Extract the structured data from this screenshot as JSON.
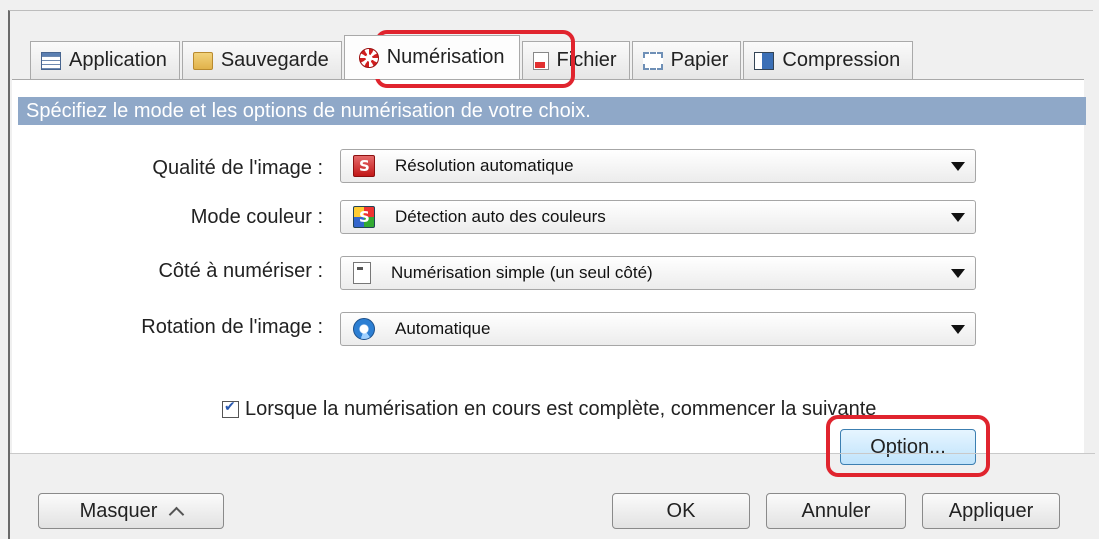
{
  "tabs": [
    {
      "label": "Application",
      "icon": "application-icon",
      "active": false
    },
    {
      "label": "Sauvegarde",
      "icon": "folder-icon",
      "active": false
    },
    {
      "label": "Numérisation",
      "icon": "scan-icon",
      "active": true
    },
    {
      "label": "Fichier",
      "icon": "file-icon",
      "active": false
    },
    {
      "label": "Papier",
      "icon": "paper-icon",
      "active": false
    },
    {
      "label": "Compression",
      "icon": "compression-icon",
      "active": false
    }
  ],
  "header": {
    "text": "Spécifiez le mode et les options de numérisation de votre choix."
  },
  "settings": {
    "quality": {
      "label": "Qualité de l'image :",
      "value": "Résolution automatique",
      "icon": "quality-icon"
    },
    "color": {
      "label": "Mode couleur :",
      "value": "Détection auto des couleurs",
      "icon": "color-icon"
    },
    "side": {
      "label": "Côté à numériser :",
      "value": "Numérisation simple (un seul côté)",
      "icon": "single-side-icon"
    },
    "rotation": {
      "label": "Rotation de l'image :",
      "value": "Automatique",
      "icon": "rotation-icon"
    }
  },
  "continue_scan": {
    "label": "Lorsque la numérisation en cours est complète, commencer la suivante",
    "checked": true
  },
  "buttons": {
    "option": "Option...",
    "hide": "Masquer",
    "ok": "OK",
    "cancel": "Annuler",
    "apply": "Appliquer"
  },
  "colors": {
    "header_bar": "#8fa8c8",
    "highlight": "#e0242e",
    "option_button": "#bfe3fb"
  }
}
